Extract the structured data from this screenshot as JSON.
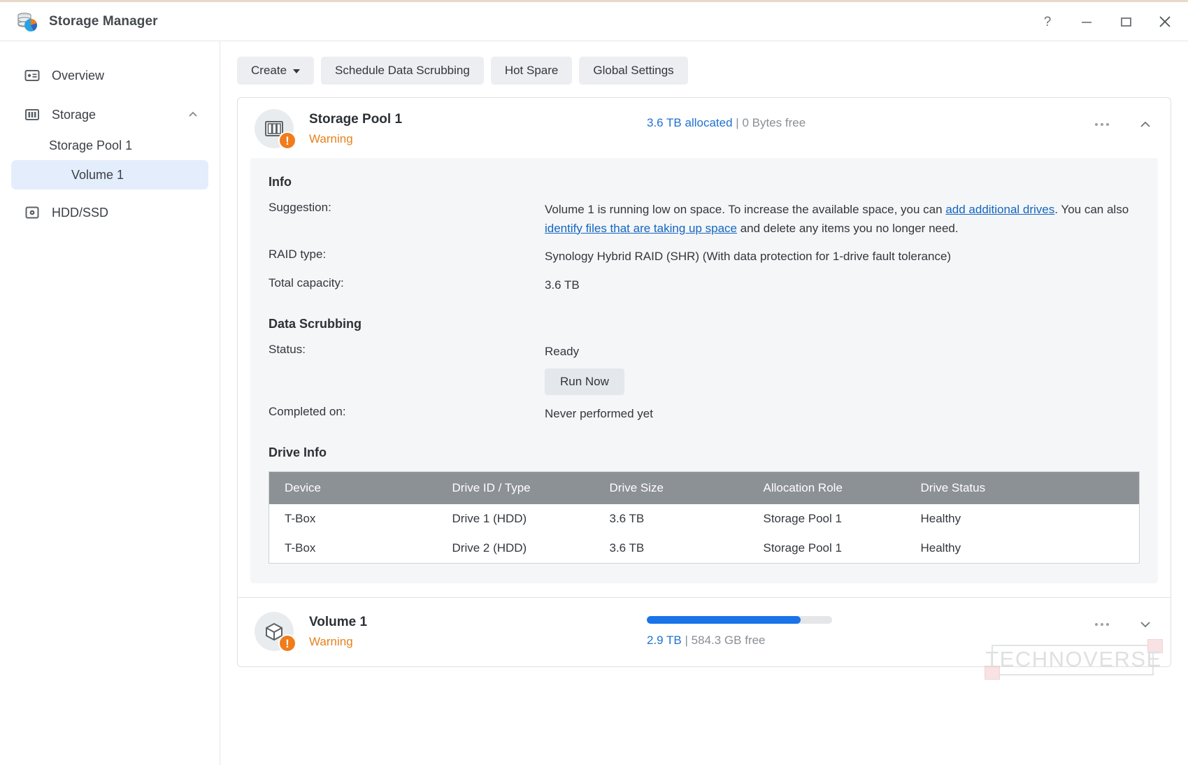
{
  "window": {
    "title": "Storage Manager",
    "app_icon": "storage-manager-icon",
    "controls": {
      "help": "?",
      "minimize": "—",
      "maximize": "☐",
      "close": "✕"
    }
  },
  "sidebar": {
    "items": [
      {
        "label": "Overview",
        "icon": "overview-icon",
        "level": 0,
        "selected": false
      },
      {
        "label": "Storage",
        "icon": "storage-icon",
        "level": 0,
        "selected": false,
        "expanded": true,
        "chevron": "chevron-up-icon"
      },
      {
        "label": "Storage Pool 1",
        "icon": "",
        "level": 1,
        "selected": false
      },
      {
        "label": "Volume 1",
        "icon": "",
        "level": 2,
        "selected": true
      },
      {
        "label": "HDD/SSD",
        "icon": "hdd-ssd-icon",
        "level": 0,
        "selected": false
      }
    ]
  },
  "toolbar": {
    "create_label": "Create",
    "schedule_label": "Schedule Data Scrubbing",
    "hot_spare_label": "Hot Spare",
    "global_settings_label": "Global Settings"
  },
  "pool": {
    "name": "Storage Pool 1",
    "status": "Warning",
    "status_color": "#e8811c",
    "allocated": "3.6 TB allocated",
    "separator": "|",
    "free": "0 Bytes free",
    "icon": "drive-bay-icon",
    "warning_badge": "!",
    "info": {
      "section_title": "Info",
      "suggestion_label": "Suggestion:",
      "suggestion_part1": "Volume 1 is running low on space. To increase the available space, you can ",
      "suggestion_link1": "add additional drives",
      "suggestion_part2": ". You can also ",
      "suggestion_link2": "identify files that are taking up space",
      "suggestion_part3": " and delete any items you no longer need.",
      "raid_label": "RAID type:",
      "raid_value": "Synology Hybrid RAID (SHR) (With data protection for 1-drive fault tolerance)",
      "capacity_label": "Total capacity:",
      "capacity_value": "3.6 TB"
    },
    "scrubbing": {
      "section_title": "Data Scrubbing",
      "status_label": "Status:",
      "status_value": "Ready",
      "run_now_label": "Run Now",
      "completed_label": "Completed on:",
      "completed_value": "Never performed yet"
    },
    "drive_info": {
      "section_title": "Drive Info",
      "columns": [
        "Device",
        "Drive ID / Type",
        "Drive Size",
        "Allocation Role",
        "Drive Status"
      ],
      "rows": [
        {
          "device": "T-Box",
          "drive_id": "Drive 1 (HDD)",
          "size": "3.6 TB",
          "role": "Storage Pool 1",
          "status": "Healthy"
        },
        {
          "device": "T-Box",
          "drive_id": "Drive 2 (HDD)",
          "size": "3.6 TB",
          "role": "Storage Pool 1",
          "status": "Healthy"
        }
      ],
      "status_color": "#1aa824"
    }
  },
  "volume": {
    "name": "Volume 1",
    "status": "Warning",
    "icon": "volume-cube-icon",
    "warning_badge": "!",
    "used": "2.9 TB",
    "separator": "|",
    "free": "584.3 GB free",
    "progress_percent": 83,
    "bar_color": "#1a73e8"
  },
  "watermark": {
    "text": "TECHNOVERSE"
  },
  "colors": {
    "accent": "#1a73e8",
    "link": "#1565c0",
    "warning": "#e8811c",
    "healthy": "#1aa824",
    "selected_nav": "#e4edfb"
  }
}
